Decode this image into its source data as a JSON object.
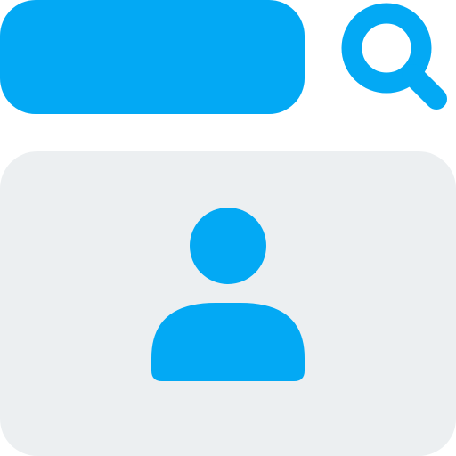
{
  "colors": {
    "accent": "#03a9f4",
    "card_background": "#eceff1",
    "page_background": "#ffffff"
  },
  "search": {
    "icon": "magnifying-glass"
  },
  "profile": {
    "icon": "user-silhouette"
  }
}
